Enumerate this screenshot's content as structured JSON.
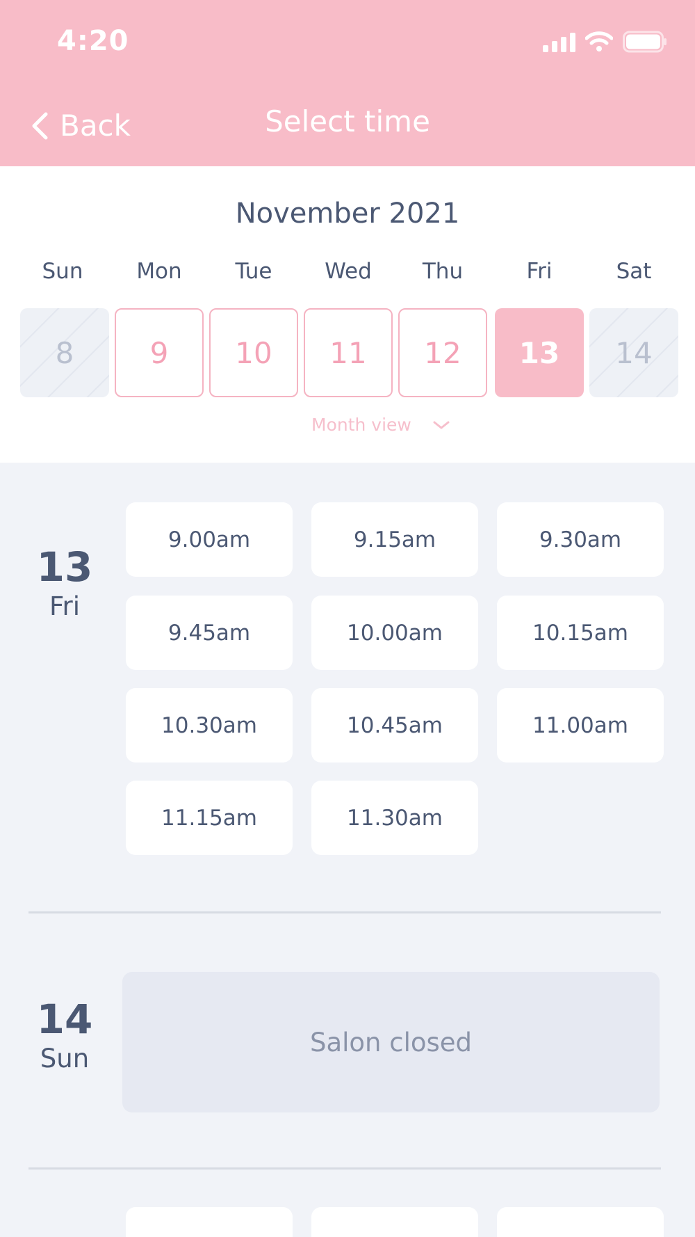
{
  "status": {
    "time": "4:20"
  },
  "nav": {
    "back_label": "Back",
    "title": "Select time"
  },
  "calendar": {
    "month": "November 2021",
    "weekdays": [
      "Sun",
      "Mon",
      "Tue",
      "Wed",
      "Thu",
      "Fri",
      "Sat"
    ],
    "days": [
      "8",
      "9",
      "10",
      "11",
      "12",
      "13",
      "14"
    ],
    "selected_day": "13",
    "month_view_label": "Month view"
  },
  "day1": {
    "num": "13",
    "name": "Fri",
    "slots": [
      "9.00am",
      "9.15am",
      "9.30am",
      "9.45am",
      "10.00am",
      "10.15am",
      "10.30am",
      "10.45am",
      "11.00am",
      "11.15am",
      "11.30am"
    ]
  },
  "day2": {
    "num": "14",
    "name": "Sun",
    "closed_label": "Salon closed"
  },
  "colors": {
    "accent": "#f8bcc8",
    "text": "#4b5873",
    "background": "#f1f3f8"
  }
}
